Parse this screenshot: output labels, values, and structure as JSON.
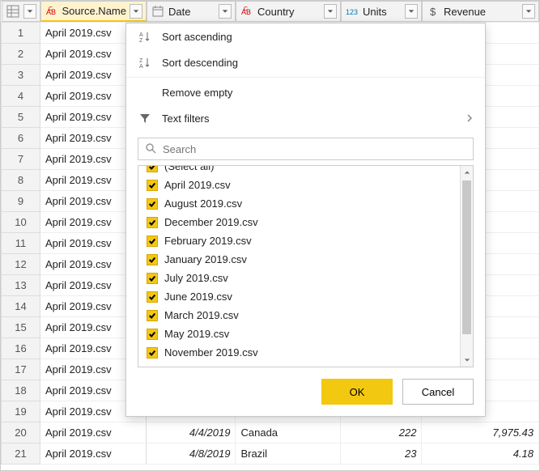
{
  "columns": {
    "rowcol": "",
    "source_name": "Source.Name",
    "date": "Date",
    "country": "Country",
    "units": "Units",
    "revenue": "Revenue"
  },
  "rows": [
    {
      "n": "1",
      "src": "April 2019.csv"
    },
    {
      "n": "2",
      "src": "April 2019.csv"
    },
    {
      "n": "3",
      "src": "April 2019.csv"
    },
    {
      "n": "4",
      "src": "April 2019.csv"
    },
    {
      "n": "5",
      "src": "April 2019.csv"
    },
    {
      "n": "6",
      "src": "April 2019.csv"
    },
    {
      "n": "7",
      "src": "April 2019.csv"
    },
    {
      "n": "8",
      "src": "April 2019.csv"
    },
    {
      "n": "9",
      "src": "April 2019.csv"
    },
    {
      "n": "10",
      "src": "April 2019.csv"
    },
    {
      "n": "11",
      "src": "April 2019.csv"
    },
    {
      "n": "12",
      "src": "April 2019.csv"
    },
    {
      "n": "13",
      "src": "April 2019.csv"
    },
    {
      "n": "14",
      "src": "April 2019.csv"
    },
    {
      "n": "15",
      "src": "April 2019.csv"
    },
    {
      "n": "16",
      "src": "April 2019.csv"
    },
    {
      "n": "17",
      "src": "April 2019.csv"
    },
    {
      "n": "18",
      "src": "April 2019.csv"
    },
    {
      "n": "19",
      "src": "April 2019.csv"
    },
    {
      "n": "20",
      "src": "April 2019.csv",
      "date": "4/4/2019",
      "country": "Canada",
      "units": "222",
      "revenue": "7,975.43"
    },
    {
      "n": "21",
      "src": "April 2019.csv",
      "date": "4/8/2019",
      "country": "Brazil",
      "units": "23",
      "revenue": "4.18"
    }
  ],
  "menu": {
    "sort_asc": "Sort ascending",
    "sort_desc": "Sort descending",
    "remove_empty": "Remove empty",
    "text_filters": "Text filters"
  },
  "search": {
    "placeholder": "Search"
  },
  "filter_items": [
    "(Select all)",
    "April 2019.csv",
    "August 2019.csv",
    "December 2019.csv",
    "February 2019.csv",
    "January 2019.csv",
    "July 2019.csv",
    "June 2019.csv",
    "March 2019.csv",
    "May 2019.csv",
    "November 2019.csv"
  ],
  "buttons": {
    "ok": "OK",
    "cancel": "Cancel"
  }
}
